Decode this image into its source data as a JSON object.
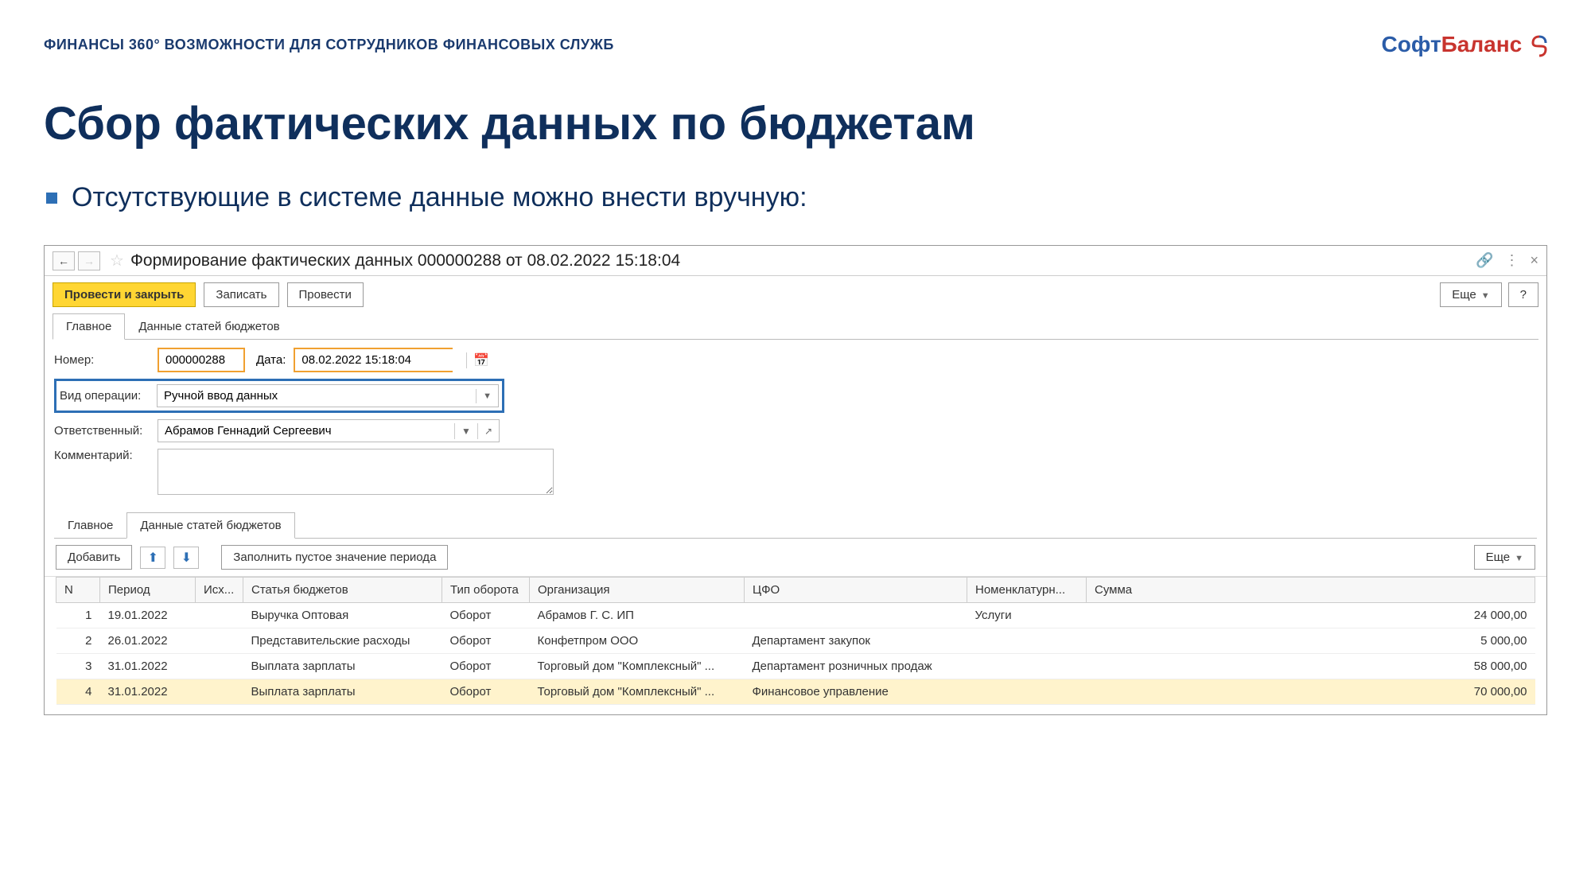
{
  "header": "ФИНАНСЫ 360° ВОЗМОЖНОСТИ ДЛЯ СОТРУДНИКОВ ФИНАНСОВЫХ СЛУЖБ",
  "logo": {
    "part1": "Софт",
    "part2": "Баланс"
  },
  "title": "Сбор фактических данных по бюджетам",
  "bullet": "Отсутствующие в системе данные можно внести вручную:",
  "window": {
    "title": "Формирование фактических данных 000000288 от 08.02.2022 15:18:04",
    "toolbar": {
      "post_close": "Провести и закрыть",
      "save": "Записать",
      "post": "Провести",
      "more": "Еще",
      "help": "?"
    },
    "tabs": {
      "main": "Главное",
      "data": "Данные статей бюджетов"
    },
    "form": {
      "number_label": "Номер:",
      "number_value": "000000288",
      "date_label": "Дата:",
      "date_value": "08.02.2022 15:18:04",
      "operation_label": "Вид операции:",
      "operation_value": "Ручной ввод данных",
      "responsible_label": "Ответственный:",
      "responsible_value": "Абрамов Геннадий Сергеевич",
      "comment_label": "Комментарий:"
    },
    "sub_toolbar": {
      "add": "Добавить",
      "fill": "Заполнить пустое значение периода",
      "more": "Еще"
    },
    "table": {
      "headers": {
        "n": "N",
        "period": "Период",
        "source": "Исх...",
        "article": "Статья бюджетов",
        "type": "Тип оборота",
        "org": "Организация",
        "cfo": "ЦФО",
        "nom": "Номенклатурн...",
        "sum": "Сумма"
      },
      "rows": [
        {
          "n": "1",
          "period": "19.01.2022",
          "source": "",
          "article": "Выручка Оптовая",
          "type": "Оборот",
          "org": "Абрамов Г. С. ИП",
          "cfo": "",
          "nom": "Услуги",
          "sum": "24 000,00"
        },
        {
          "n": "2",
          "period": "26.01.2022",
          "source": "",
          "article": "Представительские расходы",
          "type": "Оборот",
          "org": "Конфетпром ООО",
          "cfo": "Департамент закупок",
          "nom": "",
          "sum": "5 000,00"
        },
        {
          "n": "3",
          "period": "31.01.2022",
          "source": "",
          "article": "Выплата зарплаты",
          "type": "Оборот",
          "org": "Торговый дом \"Комплексный\" ...",
          "cfo": "Департамент розничных продаж",
          "nom": "",
          "sum": "58 000,00"
        },
        {
          "n": "4",
          "period": "31.01.2022",
          "source": "",
          "article": "Выплата зарплаты",
          "type": "Оборот",
          "org": "Торговый дом \"Комплексный\" ...",
          "cfo": "Финансовое управление",
          "nom": "",
          "sum": "70 000,00"
        }
      ]
    }
  }
}
